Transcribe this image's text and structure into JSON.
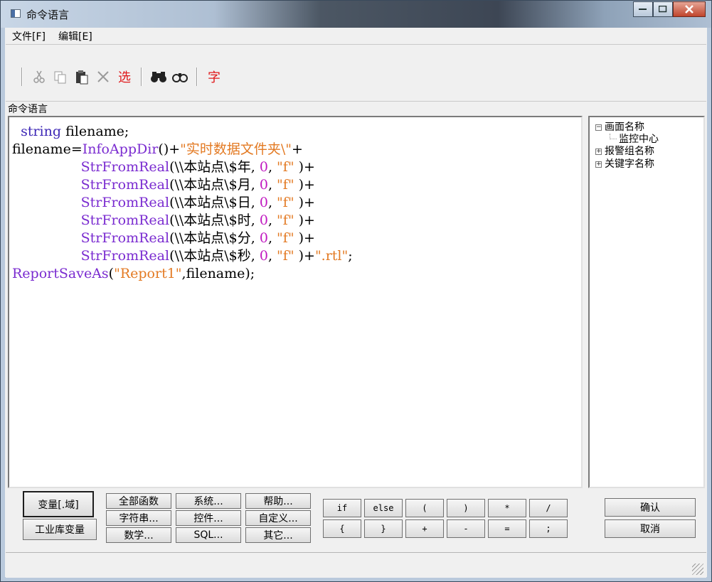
{
  "window": {
    "title": "命令语言"
  },
  "menu": {
    "file": "文件[F]",
    "edit": "编辑[E]"
  },
  "toolbar": {
    "cut_icon": "cut-icon",
    "copy_icon": "copy-icon",
    "paste_icon": "paste-icon",
    "delete_icon": "delete-icon",
    "select_label": "选",
    "find_icon": "find-icon",
    "replace_icon": "binoculars-icon",
    "font_label": "字"
  },
  "section_label": "命令语言",
  "code": [
    "  string filename;",
    "filename=InfoAppDir()+\"实时数据文件夹\\\"+",
    "                StrFromReal(\\\\本站点\\$年, 0, \"f\" )+",
    "                StrFromReal(\\\\本站点\\$月, 0, \"f\" )+",
    "                StrFromReal(\\\\本站点\\$日, 0, \"f\" )+",
    "                StrFromReal(\\\\本站点\\$时, 0, \"f\" )+",
    "                StrFromReal(\\\\本站点\\$分, 0, \"f\" )+",
    "                StrFromReal(\\\\本站点\\$秒, 0, \"f\" )+\".rtl\";",
    "ReportSaveAs(\"Report1\",filename);"
  ],
  "tree": {
    "root": "画面名称",
    "child": "监控中心",
    "alarm_group": "报警组名称",
    "keyword": "关键字名称"
  },
  "buttons": {
    "var_domain": "变量[.域]",
    "industrial_var": "工业库变量",
    "all_functions": "全部函数",
    "system": "系统...",
    "help": "帮助...",
    "string": "字符串...",
    "control": "控件...",
    "custom": "自定义...",
    "math": "数学...",
    "sql": "SQL...",
    "other": "其它...",
    "confirm": "确认",
    "cancel": "取消"
  },
  "operators": [
    "if",
    "else",
    "(",
    ")",
    "*",
    "/",
    "{",
    "}",
    "+",
    "-",
    "=",
    ";"
  ],
  "colors": {
    "keyword": "#3d27b6",
    "function": "#7a2bd0",
    "string": "#e37a23",
    "number": "#c018c0",
    "toolbar_red": "#e0181a"
  }
}
